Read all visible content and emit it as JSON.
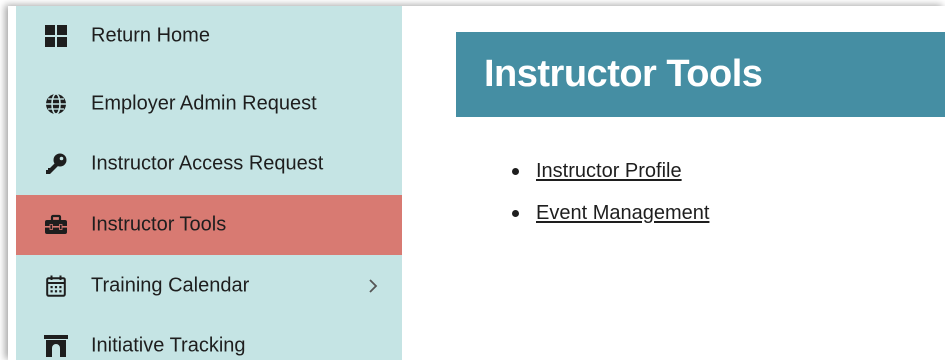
{
  "sidebar": {
    "items": [
      {
        "label": "Return Home",
        "icon": "grid-icon"
      },
      {
        "label": "Employer Admin Request",
        "icon": "globe-icon"
      },
      {
        "label": "Instructor Access Request",
        "icon": "key-icon"
      },
      {
        "label": "Instructor Tools",
        "icon": "toolbox-icon",
        "active": true
      },
      {
        "label": "Training Calendar",
        "icon": "calendar-icon",
        "has_submenu": true
      },
      {
        "label": "Initiative Tracking",
        "icon": "archway-icon"
      }
    ]
  },
  "main": {
    "title": "Instructor Tools",
    "links": [
      {
        "label": "Instructor Profile"
      },
      {
        "label": "Event Management"
      }
    ]
  },
  "colors": {
    "sidebar_bg": "#c5e4e4",
    "active_item_bg": "#d87a72",
    "title_bar_bg": "#458ea3",
    "text": "#1e1e1e"
  }
}
